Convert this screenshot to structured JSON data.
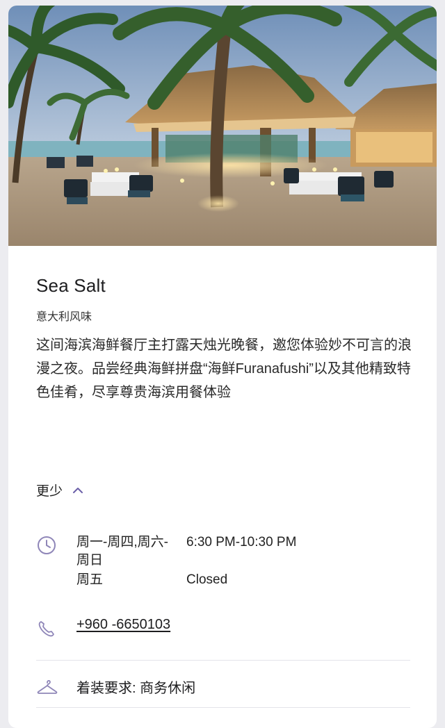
{
  "restaurant": {
    "name": "Sea Salt",
    "cuisine": "意大利风味",
    "description": "这间海滨海鲜餐厅主打露天烛光晚餐，邀您体验妙不可言的浪漫之夜。品尝经典海鲜拼盘“海鲜Furanafushi”以及其他精致特色佳肴，尽享尊贵海滨用餐体验"
  },
  "toggle": {
    "label": "更少",
    "icon": "chevron-up-icon"
  },
  "hours": {
    "icon": "clock-icon",
    "rows": [
      {
        "days": "周一-周四,周六-周日",
        "time": "6:30 PM-10:30 PM"
      },
      {
        "days": "周五",
        "time": "Closed"
      }
    ]
  },
  "phone": {
    "icon": "phone-icon",
    "number": "+960 -6650103"
  },
  "dress_code": {
    "icon": "hanger-icon",
    "text": "着装要求: 商务休闲"
  },
  "colors": {
    "accent": "#6b5fa8",
    "icon": "#8f86b8",
    "divider": "#e4e4ea"
  }
}
